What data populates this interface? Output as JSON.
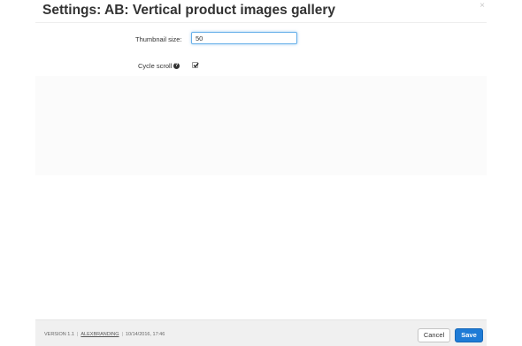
{
  "title": "Settings: AB: Vertical product images gallery",
  "close_glyph": "×",
  "form": {
    "thumbnail_size": {
      "label": "Thumbnail size:",
      "value": "50"
    },
    "cycle_scroll": {
      "label": "Cycle scroll",
      "help_glyph": "?",
      "checked": true
    }
  },
  "footer": {
    "version": "VERSION 1.1",
    "vendor": "ALEXBRANDING",
    "date": "10/14/2016, 17:46",
    "separator": "|",
    "cancel_label": "Cancel",
    "save_label": "Save"
  },
  "colors": {
    "accent": "#1e7bd6",
    "input_focus_border": "#66afe9",
    "footer_background": "#f0f0f0"
  },
  "icons": {
    "close": "close-icon",
    "help": "help-icon",
    "check": "checkmark-icon"
  }
}
